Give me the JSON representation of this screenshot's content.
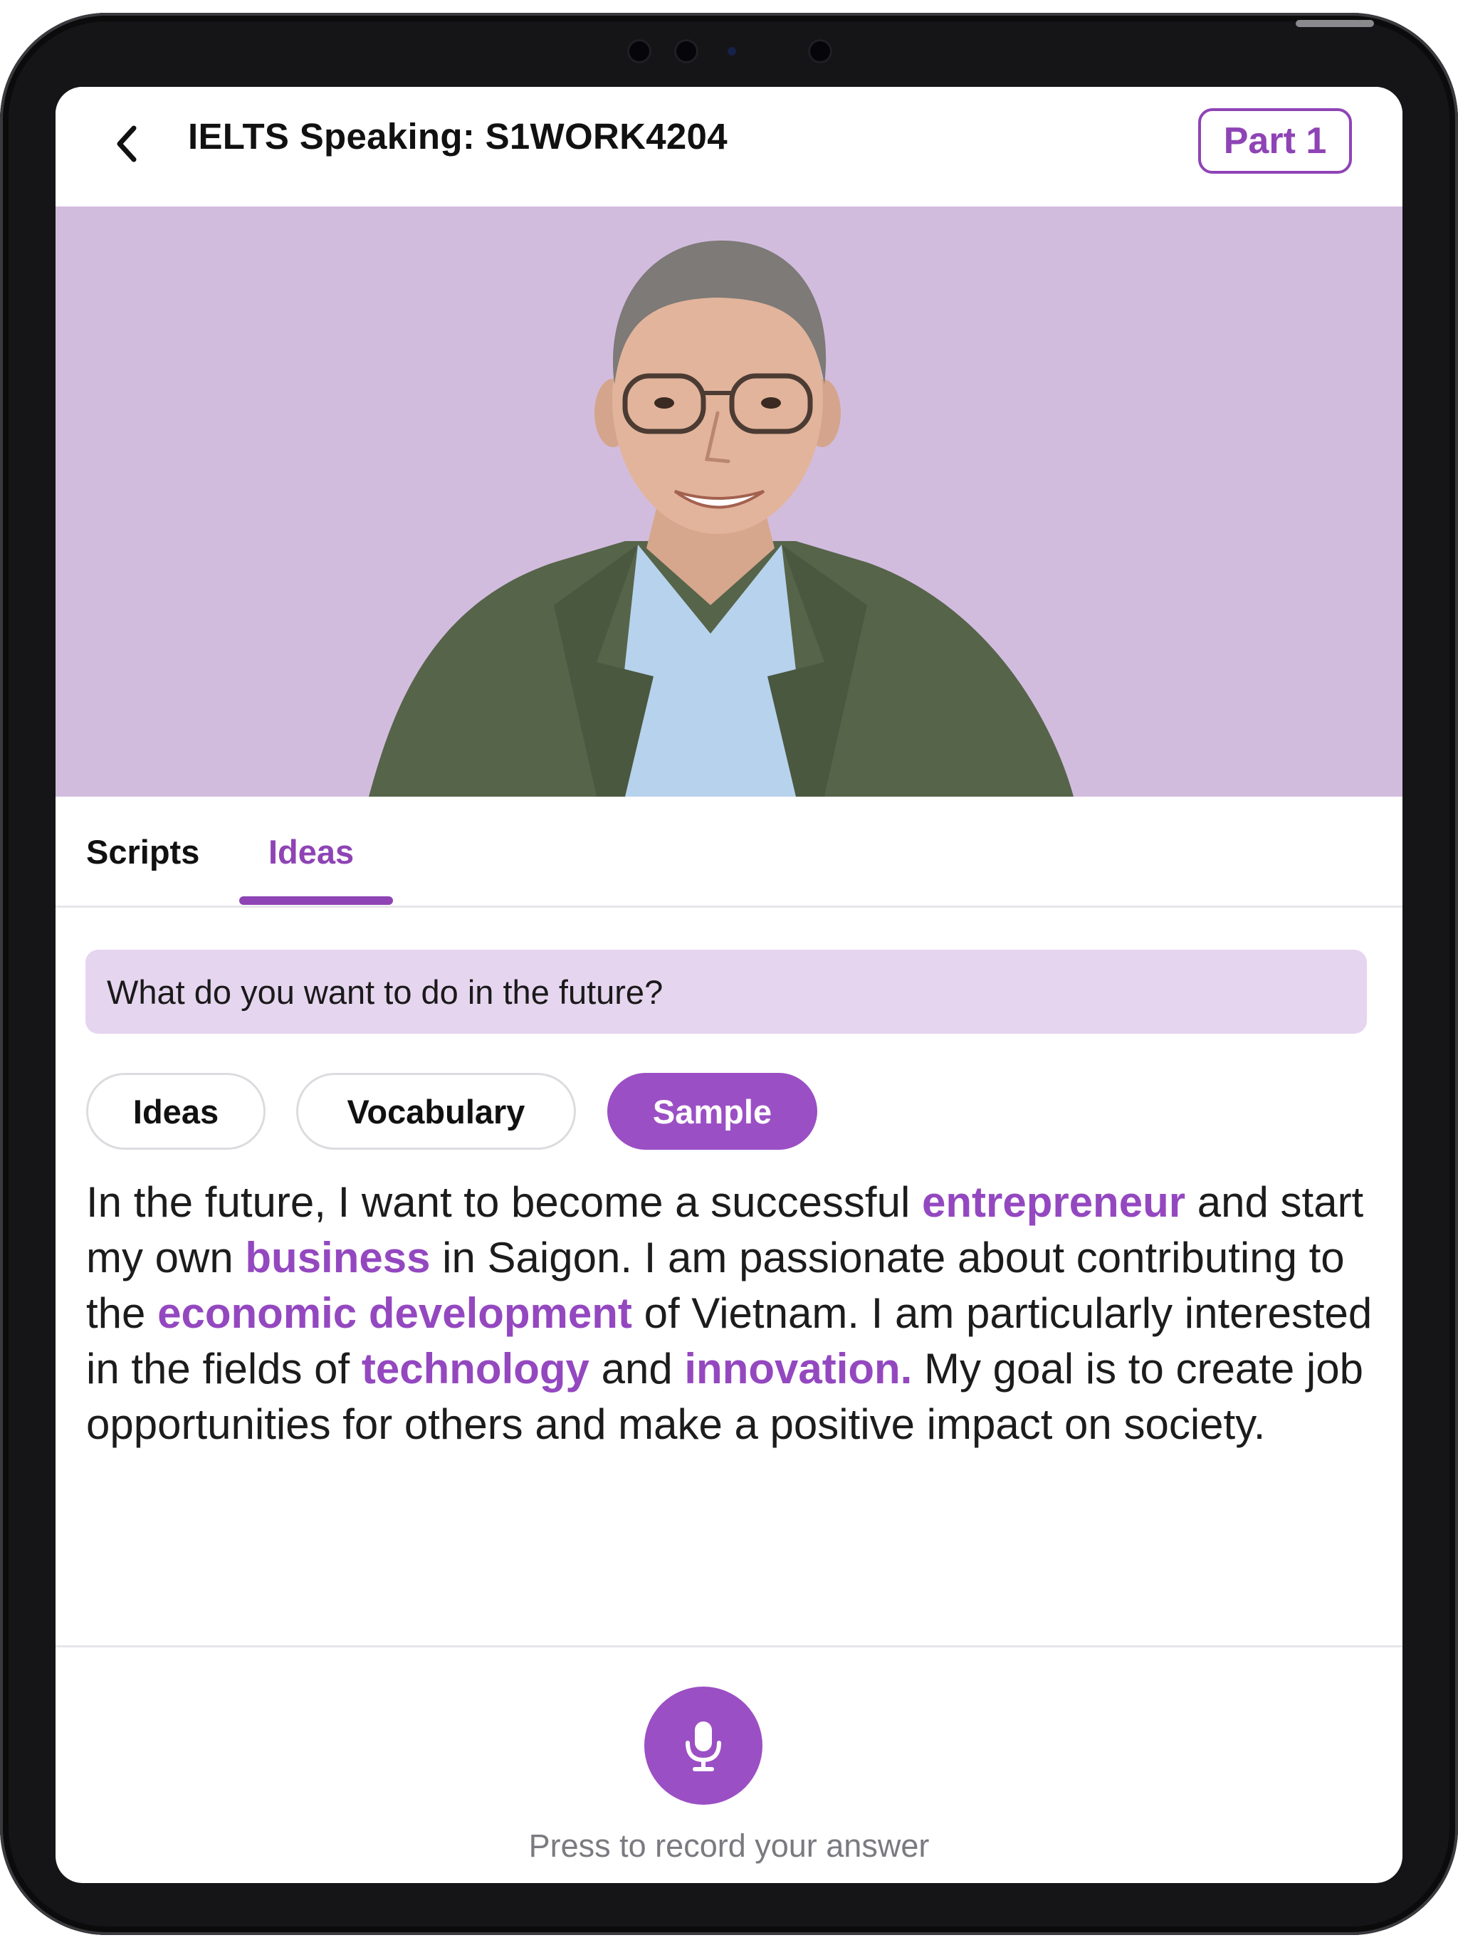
{
  "header": {
    "title": "IELTS Speaking: S1WORK4204",
    "part_label": "Part 1"
  },
  "tabs": [
    {
      "label": "Scripts",
      "active": false
    },
    {
      "label": "Ideas",
      "active": true
    }
  ],
  "question": "What do you want to do in the future?",
  "pills": [
    {
      "label": "Ideas",
      "selected": false
    },
    {
      "label": "Vocabulary",
      "selected": false
    },
    {
      "label": "Sample",
      "selected": true
    }
  ],
  "sample": {
    "t1": "In the future, I want to become a successful ",
    "k1": "entrepreneur",
    "t2": " and start my own ",
    "k2": "business",
    "t3": " in Saigon. I am passionate about contributing to the ",
    "k3": "economic development",
    "t4": " of Vietnam. I am particularly interested in the fields of ",
    "k4": "technology",
    "t5": " and ",
    "k5": "innovation.",
    "t6": " My goal is to create job opportunities for others and make a positive impact on society."
  },
  "record": {
    "hint": "Press to record your answer",
    "icon": "microphone-icon"
  },
  "colors": {
    "accent": "#9b4fc4",
    "video_bg": "#d2bcde",
    "question_bg": "#e6d5ef"
  }
}
